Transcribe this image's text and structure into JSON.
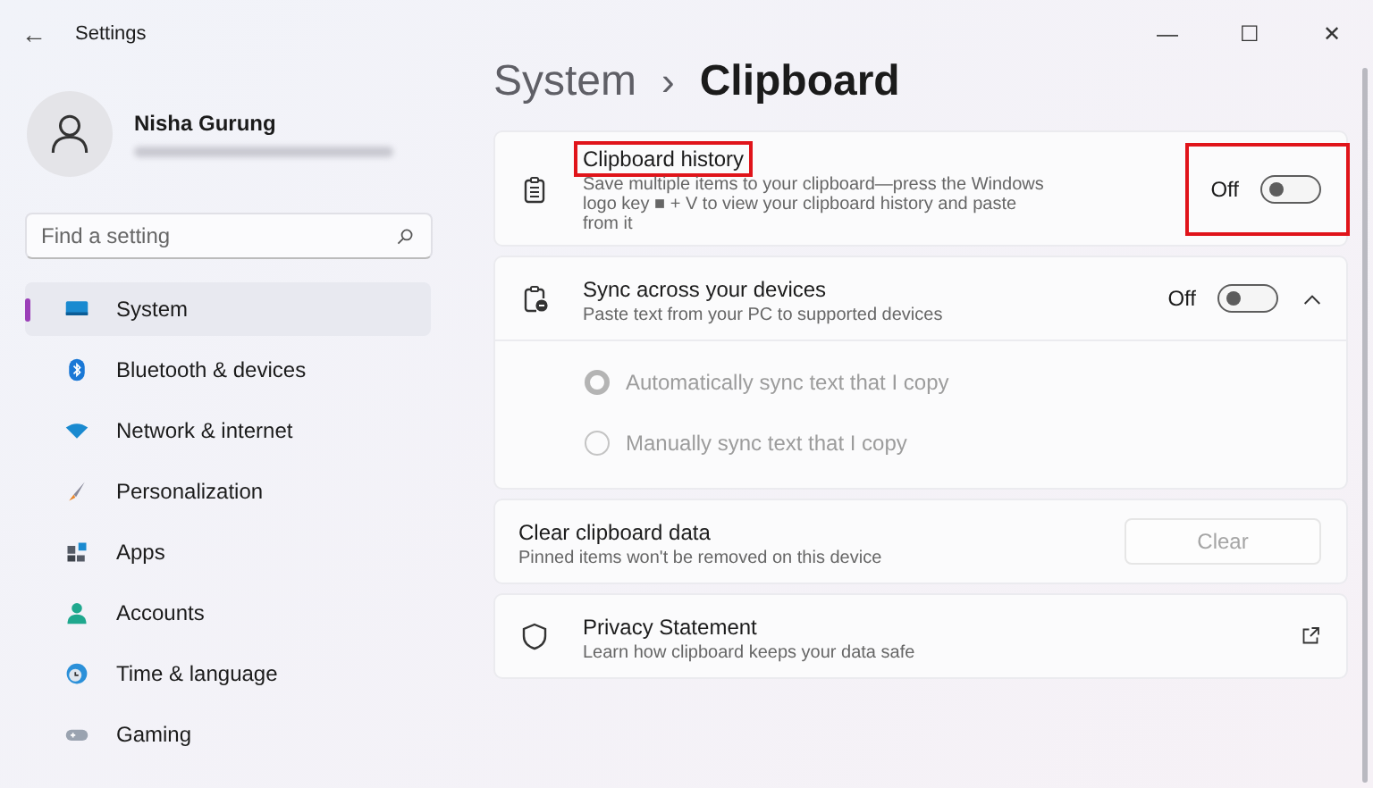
{
  "window": {
    "title": "Settings",
    "back": "←",
    "controls": [
      "—",
      "☐",
      "✕"
    ]
  },
  "account": {
    "name": "Nisha Gurung"
  },
  "search": {
    "placeholder": "Find a setting"
  },
  "sidebar": {
    "items": [
      {
        "label": "System",
        "selected": true
      },
      {
        "label": "Bluetooth & devices",
        "selected": false
      },
      {
        "label": "Network & internet",
        "selected": false
      },
      {
        "label": "Personalization",
        "selected": false
      },
      {
        "label": "Apps",
        "selected": false
      },
      {
        "label": "Accounts",
        "selected": false
      },
      {
        "label": "Time & language",
        "selected": false
      },
      {
        "label": "Gaming",
        "selected": false
      }
    ]
  },
  "breadcrumb": {
    "parent": "System",
    "separator": "›",
    "current": "Clipboard"
  },
  "cards": [
    {
      "kind": "toggle",
      "title": "Clipboard history",
      "description": "Save multiple items to your clipboard—press the Windows logo key ■ + V to view your clipboard history and paste from it",
      "state_label": "Off",
      "on": false,
      "highlighted": true
    },
    {
      "kind": "expander",
      "title": "Sync across your devices",
      "description": "Paste text from your PC to supported devices",
      "state_label": "Off",
      "on": false,
      "expanded": true,
      "options": [
        {
          "label": "Automatically sync text that I copy",
          "selected": true,
          "disabled": true
        },
        {
          "label": "Manually sync text that I copy",
          "selected": false,
          "disabled": true
        }
      ]
    },
    {
      "kind": "button",
      "title": "Clear clipboard data",
      "description": "Pinned items won't be removed on this device",
      "button": "Clear",
      "disabled": true
    },
    {
      "kind": "link",
      "title": "Privacy Statement",
      "description": "Learn how clipboard keeps your data safe"
    }
  ]
}
